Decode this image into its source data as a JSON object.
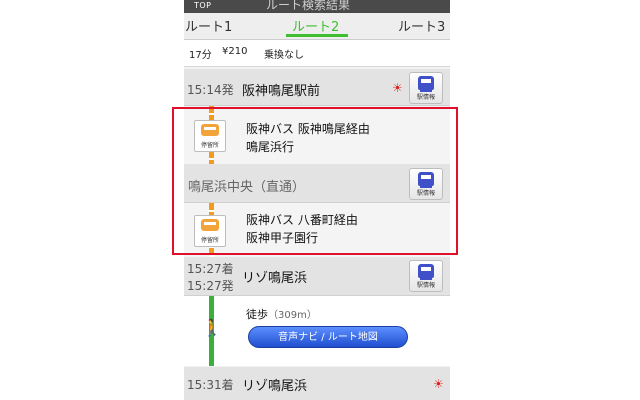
{
  "header": {
    "top_label": "TOP",
    "screen_title": "ルート検索結果"
  },
  "tabs": [
    {
      "label": "ルート1",
      "active": false
    },
    {
      "label": "ルート2",
      "active": true
    },
    {
      "label": "ルート3",
      "active": false
    }
  ],
  "summary": {
    "duration": "17分",
    "fare": "¥210",
    "transfer": "乗換なし"
  },
  "stations": [
    {
      "time": "15:14発",
      "name": "阪神鳴尾駅前",
      "button_label": "駅情報"
    },
    {
      "time": "",
      "name": "鳴尾浜中央（直通）",
      "button_label": "駅情報"
    },
    {
      "time_arr": "15:27着",
      "time_dep": "15:27発",
      "name": "リゾ鳴尾浜",
      "button_label": "駅情報"
    },
    {
      "time": "15:31着",
      "name": "リゾ鳴尾浜"
    }
  ],
  "legs": [
    {
      "line1": "阪神バス 阪神鳴尾経由",
      "line2": "鳴尾浜行",
      "stop_label": "停留所"
    },
    {
      "line1": "阪神バス 八番町経由",
      "line2": "阪神甲子園行",
      "stop_label": "停留所"
    }
  ],
  "walk": {
    "label": "徒歩",
    "distance": "（309m）",
    "nav_button": "音声ナビ / ルート地図"
  },
  "icons": {
    "weather": "sun-icon",
    "walk": "walker-icon",
    "station_info": "bus-icon"
  },
  "colors": {
    "active_tab": "#3fbf2f",
    "bus_line": "#f39a1f",
    "walk_line": "#39b03a",
    "highlight": "#e0102a",
    "nav_button": "#2a5fe0"
  }
}
